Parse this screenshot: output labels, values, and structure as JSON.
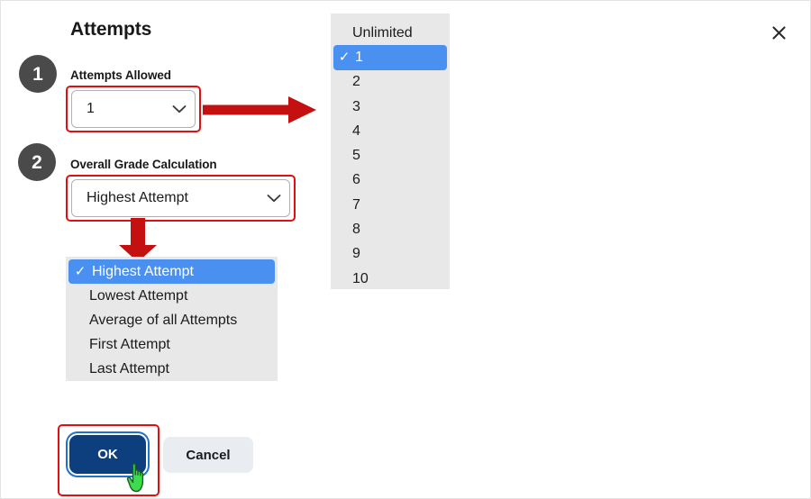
{
  "dialog": {
    "title": "Attempts",
    "close_icon": "close-x-icon"
  },
  "steps": [
    {
      "number": "1"
    },
    {
      "number": "2"
    }
  ],
  "fields": {
    "attempts_allowed": {
      "label": "Attempts Allowed",
      "value": "1",
      "chevron_icon": "chevron-down-icon"
    },
    "overall_grade_calculation": {
      "label": "Overall Grade Calculation",
      "value": "Highest Attempt",
      "chevron_icon": "chevron-down-icon"
    }
  },
  "attempts_dropdown": {
    "selected": "1",
    "check_glyph": "✓",
    "options": [
      "Unlimited",
      "1",
      "2",
      "3",
      "4",
      "5",
      "6",
      "7",
      "8",
      "9",
      "10"
    ]
  },
  "grade_dropdown": {
    "selected": "Highest Attempt",
    "check_glyph": "✓",
    "options": [
      "Highest Attempt",
      "Lowest Attempt",
      "Average of all Attempts",
      "First Attempt",
      "Last Attempt"
    ]
  },
  "footer": {
    "ok_label": "OK",
    "cancel_label": "Cancel"
  },
  "annotations": {
    "arrow_right_icon": "red-right-arrow-icon",
    "arrow_down_icon": "red-down-arrow-icon",
    "cursor_icon": "green-pointing-hand-cursor-icon",
    "highlight_color": "#e01010",
    "accent_color": "#4a90f0",
    "ok_button_color": "#0d3f7f",
    "badge_color": "#4a4a4a"
  }
}
